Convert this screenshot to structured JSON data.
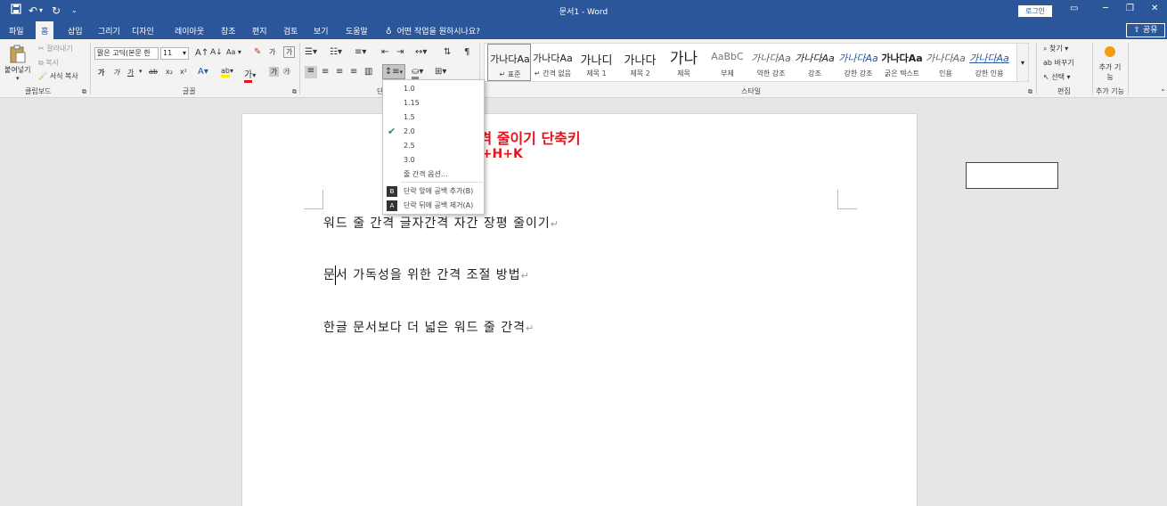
{
  "titlebar": {
    "title": "문서1 - Word",
    "login_label": "로그인",
    "save_icon": "save-icon",
    "undo_icon": "undo-icon",
    "redo_icon": "redo-icon",
    "customize_icon": "customize-qat-icon",
    "ribbon_display_icon": "ribbon-display-icon",
    "minimize_icon": "minimize-icon",
    "restore_icon": "restore-icon",
    "close_icon": "close-icon"
  },
  "tabs": [
    {
      "label": "파일"
    },
    {
      "label": "홈"
    },
    {
      "label": "삽입"
    },
    {
      "label": "그리기"
    },
    {
      "label": "디자인"
    },
    {
      "label": "레이아웃"
    },
    {
      "label": "참조"
    },
    {
      "label": "편지"
    },
    {
      "label": "검토"
    },
    {
      "label": "보기"
    },
    {
      "label": "도움말"
    }
  ],
  "tellme": {
    "text": "어떤 작업을 원하시나요?"
  },
  "share": {
    "label": "공유"
  },
  "clipboard": {
    "paste": "붙여넣기",
    "cut": "잘라내기",
    "copy": "복사",
    "format_painter": "서식 복사",
    "group": "클립보드"
  },
  "font": {
    "name": "맑은 고딕(본문 한",
    "size": "11",
    "case_label": "Aa",
    "bold": "가",
    "italic": "가",
    "underline": "가",
    "strike": "ab",
    "subscript": "x₂",
    "superscript": "x²",
    "group": "글꼴"
  },
  "paragraph": {
    "group": "단"
  },
  "styles": {
    "items": [
      {
        "sample": "가나다Aa",
        "name": "표준"
      },
      {
        "sample": "가나다Aa",
        "name": "간격 없음"
      },
      {
        "sample": "가나디",
        "name": "제목 1"
      },
      {
        "sample": "가나다",
        "name": "제목 2"
      },
      {
        "sample": "가나",
        "name": "제목"
      },
      {
        "sample": "AaBbC",
        "name": "부제"
      },
      {
        "sample": "가나다Aa",
        "name": "약한 강조"
      },
      {
        "sample": "가나다Aa",
        "name": "강조"
      },
      {
        "sample": "가나다Aa",
        "name": "강한 강조"
      },
      {
        "sample": "가나다Aa",
        "name": "굵은 텍스트"
      },
      {
        "sample": "가나다Aa",
        "name": "인용"
      },
      {
        "sample": "가나다Aa",
        "name": "강한 인용"
      }
    ],
    "group": "스타일"
  },
  "editing": {
    "find": "찾기",
    "replace": "바꾸기",
    "select": "선택",
    "group": "편집"
  },
  "addins": {
    "button": "추가 기능",
    "group": "추가 기능"
  },
  "line_spacing_menu": {
    "items": [
      {
        "label": "1.0",
        "checked": false
      },
      {
        "label": "1.15",
        "checked": false
      },
      {
        "label": "1.5",
        "checked": false
      },
      {
        "label": "2.0",
        "checked": true
      },
      {
        "label": "2.5",
        "checked": false
      },
      {
        "label": "3.0",
        "checked": false
      }
    ],
    "options_label": "줄 간격 옵션...",
    "add_before_label": "단락 앞에 공백 추가(B)",
    "remove_after_label": "단락 뒤에 공백 제거(A)",
    "add_before_key": "B",
    "remove_after_key": "A"
  },
  "annotation": {
    "line1": "줄간격 줄이기 단축키",
    "line2": ": Alt+H+K"
  },
  "document": {
    "paragraphs": [
      "워드 줄 간격 글자간격 자간 장평 줄이기",
      "문서 가독성을 위한 간격 조절 방법",
      "한글 문서보다 더 넓은 워드 줄 간격"
    ],
    "paragraph_mark": "↵"
  }
}
